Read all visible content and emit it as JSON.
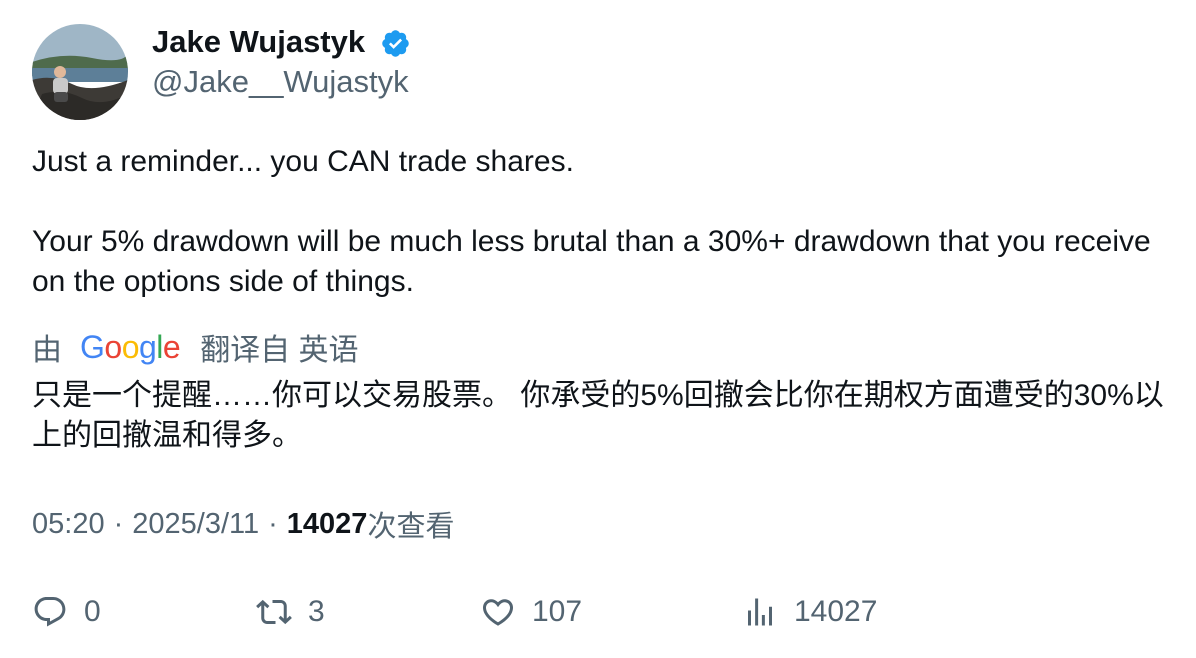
{
  "author": {
    "display_name": "Jake Wujastyk",
    "handle": "@Jake__Wujastyk",
    "verified": true
  },
  "tweet": {
    "paragraph_1": "Just a reminder... you CAN trade shares.",
    "paragraph_2": "Your 5% drawdown will be much less brutal than a 30%+ drawdown that you receive on the options side of things."
  },
  "translation": {
    "prefix": "由",
    "provider": "Google",
    "suffix": "翻译自 英语",
    "text": "只是一个提醒……你可以交易股票。 你承受的5%回撤会比你在期权方面遭受的30%以上的回撤温和得多。"
  },
  "meta": {
    "time": "05:20",
    "separator": "·",
    "date": "2025/3/11",
    "views_count": "14027",
    "views_label": "次查看"
  },
  "actions": {
    "replies": "0",
    "retweets": "3",
    "likes": "107",
    "views": "14027"
  },
  "colors": {
    "text_primary": "#0f1419",
    "text_secondary": "#536471",
    "verified_blue": "#1d9bf0",
    "google_blue": "#4285F4",
    "google_red": "#EA4335",
    "google_yellow": "#FBBC05",
    "google_green": "#34A853"
  }
}
